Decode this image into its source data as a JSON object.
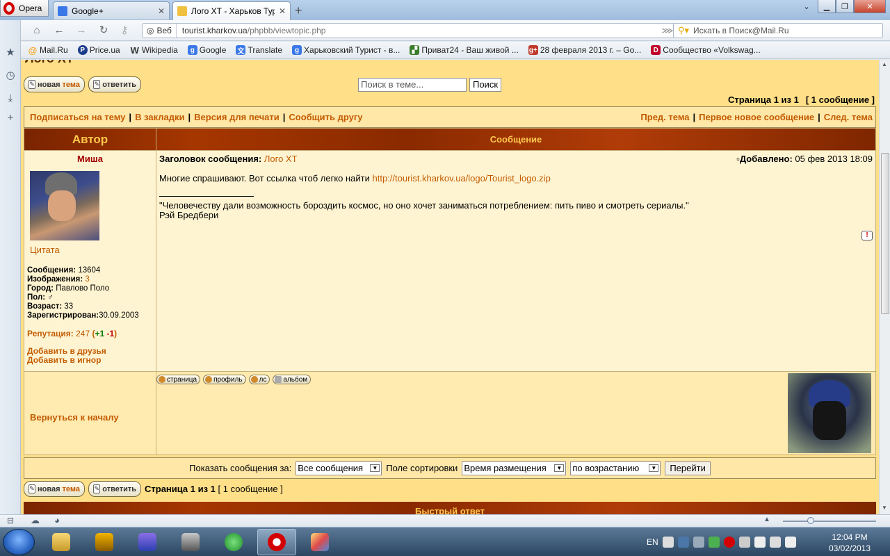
{
  "browser": {
    "opera_label": "Opera",
    "tabs": [
      {
        "label": "Google+"
      },
      {
        "label": "Лого ХТ - Харьков Тур..."
      }
    ],
    "new_tab": "+",
    "address": {
      "web_label": "Веб",
      "url_host": "tourist.kharkov.ua",
      "url_path": "/phpbb/viewtopic.php"
    },
    "search_placeholder": "Искать в Поиск@Mail.Ru",
    "bookmarks": [
      {
        "label": "Mail.Ru",
        "icon": "mailru-icon",
        "color": "#f5a623"
      },
      {
        "label": "Price.ua",
        "icon": "price-icon",
        "color": "#1b3c8c"
      },
      {
        "label": "Wikipedia",
        "icon": "wikipedia-icon",
        "color": "#333333"
      },
      {
        "label": "Google",
        "icon": "google-icon",
        "color": "#3b78e7"
      },
      {
        "label": "Translate",
        "icon": "translate-icon",
        "color": "#3b78e7"
      },
      {
        "label": "Харьковский Турист - в...",
        "icon": "tourist-icon",
        "color": "#3b78e7"
      },
      {
        "label": "Приват24 - Ваш живой ...",
        "icon": "privat-icon",
        "color": "#3a7d2c"
      },
      {
        "label": "28 февраля 2013 г. – Go...",
        "icon": "gplus-icon",
        "color": "#c0392b"
      },
      {
        "label": "Сообщество «Volkswag...",
        "icon": "vw-icon",
        "color": "#c0002a"
      }
    ]
  },
  "page": {
    "topic_title": "Лого ХТ",
    "new_topic_prefix": "новая",
    "new_topic_word": "тема",
    "reply_label": "ответить",
    "search_placeholder": "Поиск в теме...",
    "search_button": "Поиск",
    "page_info": "Страница 1 из 1",
    "msg_count": "[ 1 сообщение ]",
    "links_left": [
      "Подписаться на тему",
      "В закладки",
      "Версия для печати",
      "Сообщить другу"
    ],
    "links_right": [
      "Пред. тема",
      "Первое новое сообщение",
      "След. тема"
    ],
    "header_author": "Автор",
    "header_message": "Сообщение",
    "post": {
      "author": "Миша",
      "quote_link": "Цитата",
      "stats": {
        "posts_label": "Сообщения:",
        "posts": "13604",
        "images_label": "Изображения:",
        "images": "3",
        "city_label": "Город:",
        "city": "Павлово Поло",
        "gender_label": "Пол:",
        "gender": "♂",
        "age_label": "Возраст:",
        "age": "33",
        "registered_label": "Зарегистрирован:",
        "registered": "30.09.2003"
      },
      "reputation_label": "Репутация:",
      "reputation": "247",
      "rep_plus": "+1",
      "rep_minus": "-1",
      "add_friend": "Добавить в друзья",
      "add_ignore": "Добавить в игнор",
      "subject_label": "Заголовок сообщения:",
      "subject": "Лого ХТ",
      "date_label": "Добавлено:",
      "date": "05 фев 2013 18:09",
      "body_text": "Многие спрашивают. Вот ссылка чтоб легко найти",
      "body_link": "http://tourist.kharkov.ua/logo/Tourist_logo.zip",
      "signature_quote": "\"Человечеству дали возможность бороздить космос, но оно хочет заниматься потреблением: пить пиво и смотреть сериалы.\"",
      "signature_author": "Рэй Бредбери",
      "report_icon": "!",
      "back_to_top": "Вернуться к началу",
      "profile_buttons": [
        "страница",
        "профиль",
        "лс",
        "альбом"
      ]
    },
    "bottom": {
      "show_label": "Показать сообщения за:",
      "show_value": "Все сообщения",
      "sort_label": "Поле сортировки",
      "sort_value": "Время размещения",
      "order_value": "по возрастанию",
      "go_button": "Перейти",
      "page_info": "Страница 1 из 1",
      "msg_count": "[ 1 сообщение ]",
      "quick_reply": "Быстрый ответ"
    }
  },
  "taskbar": {
    "lang": "EN",
    "time": "12:04 PM",
    "date": "03/02/2013"
  }
}
